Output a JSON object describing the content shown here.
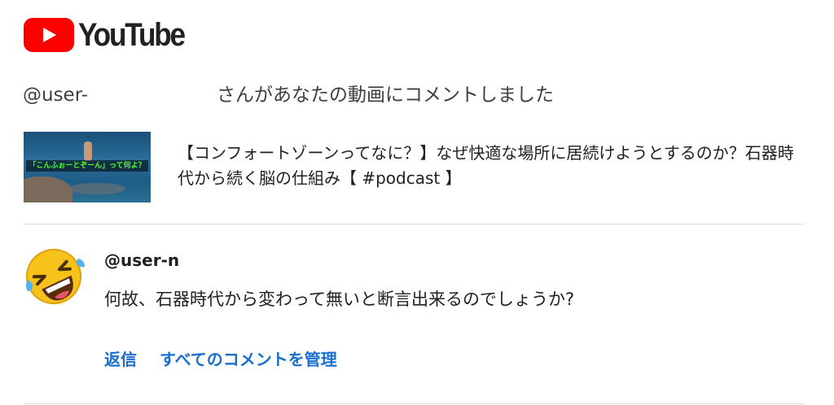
{
  "brand": {
    "logo_icon": "youtube-play-icon",
    "name": "YouTube",
    "accent_color": "#ff0000"
  },
  "notification": {
    "handle": "@user-",
    "message": "さんがあなたの動画にコメントしました"
  },
  "video": {
    "thumbnail_caption": "「こんふぉーとぞーん」って何よ？",
    "title": "【コンフォートゾーンってなに？】なぜ快適な場所に居続けようとするのか？石器時代から続く脳の仕組み【 #podcast 】"
  },
  "comment": {
    "avatar_icon": "rolling-on-floor-laughing-emoji-icon",
    "author": "@user-n",
    "text": "何故、石器時代から変わって無いと断言出来るのでしょうか?"
  },
  "actions": {
    "reply_label": "返信",
    "manage_label": "すべてのコメントを管理",
    "link_color": "#1a6fce"
  }
}
